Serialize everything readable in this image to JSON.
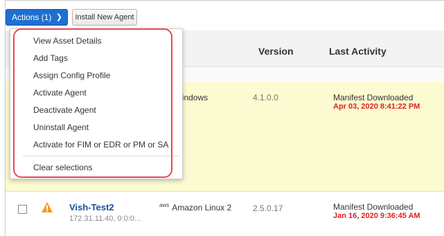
{
  "toolbar": {
    "actions_label": "Actions (1)",
    "install_label": "Install New Agent"
  },
  "table": {
    "headers": [
      "Version",
      "Last Activity"
    ],
    "rows": [
      {
        "os_partial": "Vindows",
        "version": "4.1.0.0",
        "activity": "Manifest Downloaded",
        "activity_time": "Apr 03, 2020 8:41:22 PM"
      },
      {
        "hostname": "Vish-Test2",
        "ip": "172.31.11.40, 0:0:0...",
        "os_badge": "aws",
        "os": "Amazon Linux 2",
        "version": "2.5.0.17",
        "activity": "Manifest Downloaded",
        "activity_time": "Jan 16, 2020 9:36:45 AM"
      }
    ]
  },
  "menu": {
    "items": [
      "View Asset Details",
      "Add Tags",
      "Assign Config Profile",
      "Activate Agent",
      "Deactivate Agent",
      "Uninstall Agent",
      "Activate for FIM or EDR or PM or SA"
    ],
    "clear_label": "Clear selections"
  },
  "colors": {
    "primary_button": "#1e6fd0",
    "row_highlight": "#fbfad0",
    "timestamp_red": "#e02020",
    "annotation_red": "#e8484e",
    "warning_orange": "#f59a1b"
  },
  "icons": [
    "chevron-down-icon",
    "warning-icon",
    "aws-icon"
  ]
}
